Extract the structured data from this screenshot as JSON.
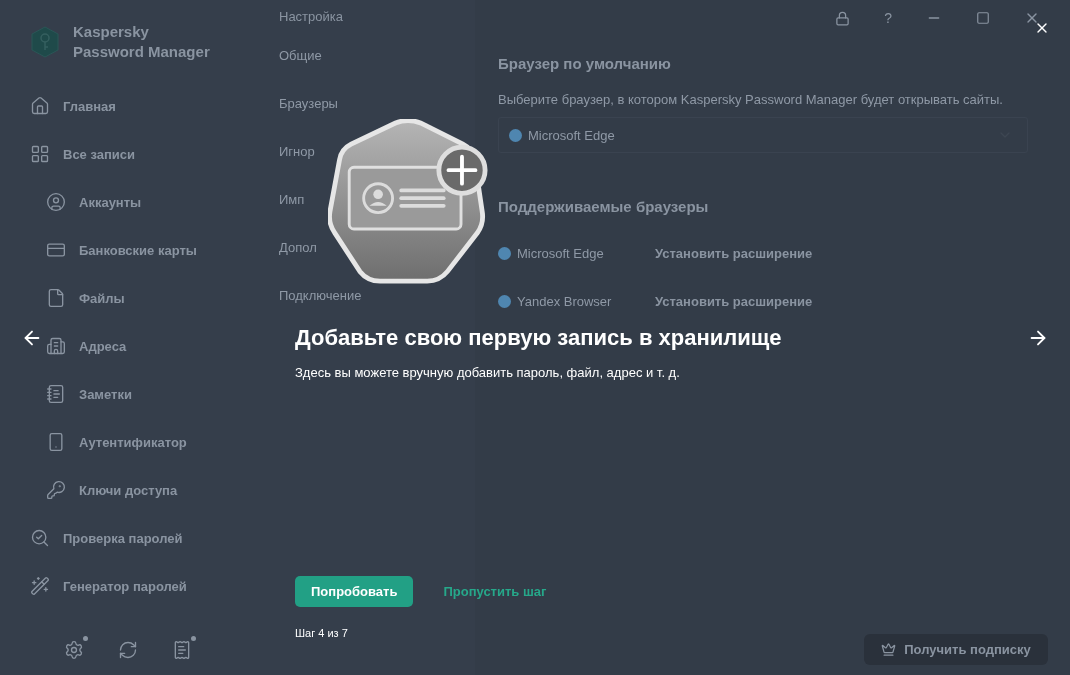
{
  "app": {
    "name": "Kaspersky Password Manager"
  },
  "sidebar": {
    "items": [
      {
        "label": "Главная",
        "kind": "home"
      },
      {
        "label": "Все записи",
        "kind": "grid",
        "children": [
          {
            "label": "Аккаунты",
            "kind": "user"
          },
          {
            "label": "Банковские карты",
            "kind": "card"
          },
          {
            "label": "Файлы",
            "kind": "file"
          },
          {
            "label": "Адреса",
            "kind": "building"
          },
          {
            "label": "Заметки",
            "kind": "note"
          },
          {
            "label": "Аутентификатор",
            "kind": "phone"
          },
          {
            "label": "Ключи доступа",
            "kind": "key"
          }
        ]
      },
      {
        "label": "Проверка паролей",
        "kind": "search-key"
      },
      {
        "label": "Генератор паролей",
        "kind": "wand"
      }
    ],
    "footer_icons": [
      {
        "kind": "settings",
        "badge": true
      },
      {
        "kind": "sync",
        "badge": false
      },
      {
        "kind": "receipt",
        "badge": true
      }
    ]
  },
  "settings": {
    "title": "Настройка",
    "nav": [
      "Общие",
      "Браузеры",
      "Игнор",
      "Имп",
      "Допол",
      "Подключение"
    ]
  },
  "window_controls": {
    "help": "?"
  },
  "content": {
    "default_browser": {
      "heading": "Браузер по умолчанию",
      "description": "Выберите браузер, в котором Kaspersky Password Manager будет открывать сайты.",
      "value": "Microsoft Edge"
    },
    "supported": {
      "heading": "Поддерживаемые браузеры",
      "browsers": [
        {
          "name": "Microsoft Edge",
          "action": "Установить расширение"
        },
        {
          "name": "Yandex Browser",
          "action": "Установить расширение"
        }
      ]
    }
  },
  "subscribe_button": "Получить подписку",
  "onboarding": {
    "title": "Добавьте свою первую запись в хранилище",
    "description": "Здесь вы можете вручную добавить пароль, файл, адрес и т. д.",
    "primary_button": "Попробовать",
    "skip_link": "Пропустить шаг",
    "step": "Шаг 4 из 7"
  }
}
